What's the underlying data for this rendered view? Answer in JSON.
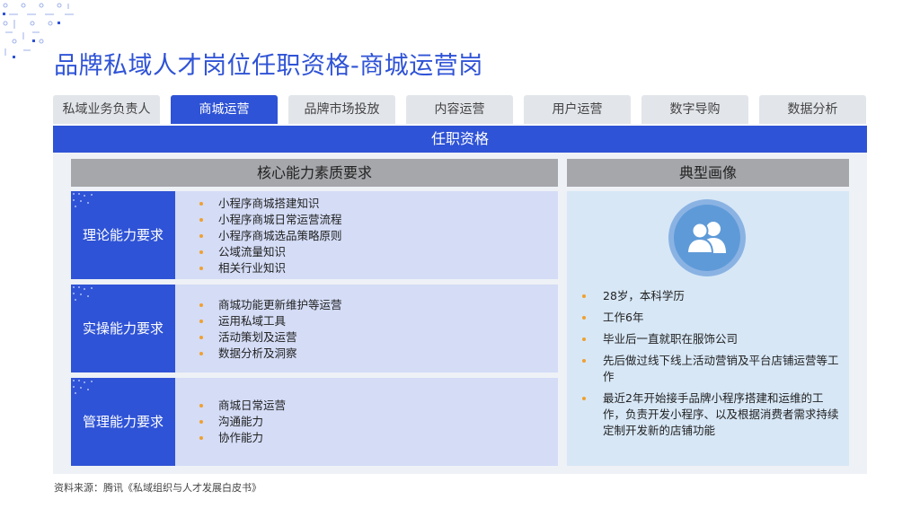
{
  "title": "品牌私域人才岗位任职资格-商城运营岗",
  "tabs": [
    {
      "label": "私域业务负责人",
      "active": false
    },
    {
      "label": "商城运营",
      "active": true
    },
    {
      "label": "品牌市场投放",
      "active": false
    },
    {
      "label": "内容运营",
      "active": false
    },
    {
      "label": "用户运营",
      "active": false
    },
    {
      "label": "数字导购",
      "active": false
    },
    {
      "label": "数据分析",
      "active": false
    }
  ],
  "banner": "任职资格",
  "left_header": "核心能力素质要求",
  "right_header": "典型画像",
  "rows": [
    {
      "label": "理论能力要求",
      "items": [
        "小程序商城搭建知识",
        "小程序商城日常运营流程",
        "小程序商城选品策略原则",
        "公域流量知识",
        "相关行业知识"
      ]
    },
    {
      "label": "实操能力要求",
      "items": [
        "商城功能更新维护等运营",
        "运用私域工具",
        "活动策划及运营",
        "数据分析及洞察"
      ]
    },
    {
      "label": "管理能力要求",
      "items": [
        "商城日常运营",
        "沟通能力",
        "协作能力"
      ]
    }
  ],
  "persona": {
    "icon": "users-icon",
    "items": [
      "28岁，本科学历",
      "工作6年",
      "毕业后一直就职在服饰公司",
      "先后做过线下线上活动营销及平台店铺运营等工作",
      "最近2年开始接手品牌小程序搭建和运维的工作，负责开发小程序、以及根据消费者需求持续定制开发新的店铺功能"
    ]
  },
  "source": "资料来源：腾讯《私域组织与人才发展白皮书》",
  "colors": {
    "accent": "#2f53d6",
    "tab_inactive": "#e2e5ea",
    "header_gray": "#a5a7ab",
    "row_bg": "#d4dcf6",
    "persona_bg": "#d7e7f6",
    "bullet": "#f0a030"
  }
}
